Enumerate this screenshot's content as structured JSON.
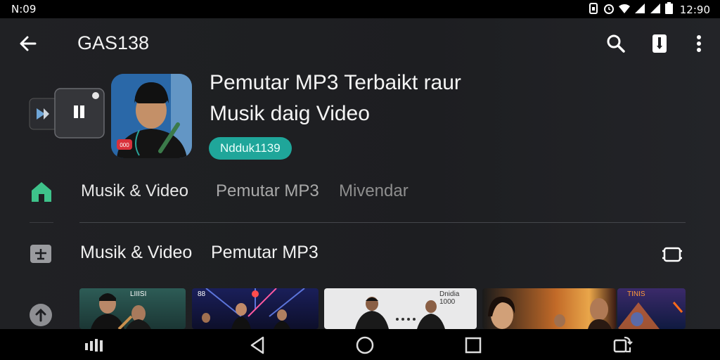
{
  "status_bar": {
    "time": "N:09",
    "clock": "12:90",
    "icons": [
      "sim-icon",
      "alarm-icon",
      "wifi-icon",
      "signal-icon",
      "signal-icon",
      "battery-icon"
    ]
  },
  "app_bar": {
    "title": "GAS138",
    "back_icon": "arrow-left-icon",
    "actions": [
      "search-icon",
      "bookmark-icon",
      "more-vert-icon"
    ]
  },
  "hero": {
    "title_line1": "Pemutar MP3 Terbaikt raur",
    "title_line2": "Musik daig Video",
    "badge": "Ndduk1139",
    "avatar_badge": "000"
  },
  "tabs": [
    {
      "label": "Musik & Video"
    },
    {
      "label": "Pemutar MP3"
    },
    {
      "label": "Mivendar"
    }
  ],
  "section": {
    "label1": "Musik & Video",
    "label2": "Pemutar MP3"
  },
  "thumbnails": [
    {
      "caption": "LIIISI"
    },
    {
      "caption": "88"
    },
    {
      "caption": "Dnidia 1000"
    },
    {
      "caption": ""
    },
    {
      "caption": "TINIS"
    }
  ],
  "colors": {
    "accent": "#1fa69a",
    "home_icon": "#3ec28a",
    "background": "#1e1f22"
  }
}
